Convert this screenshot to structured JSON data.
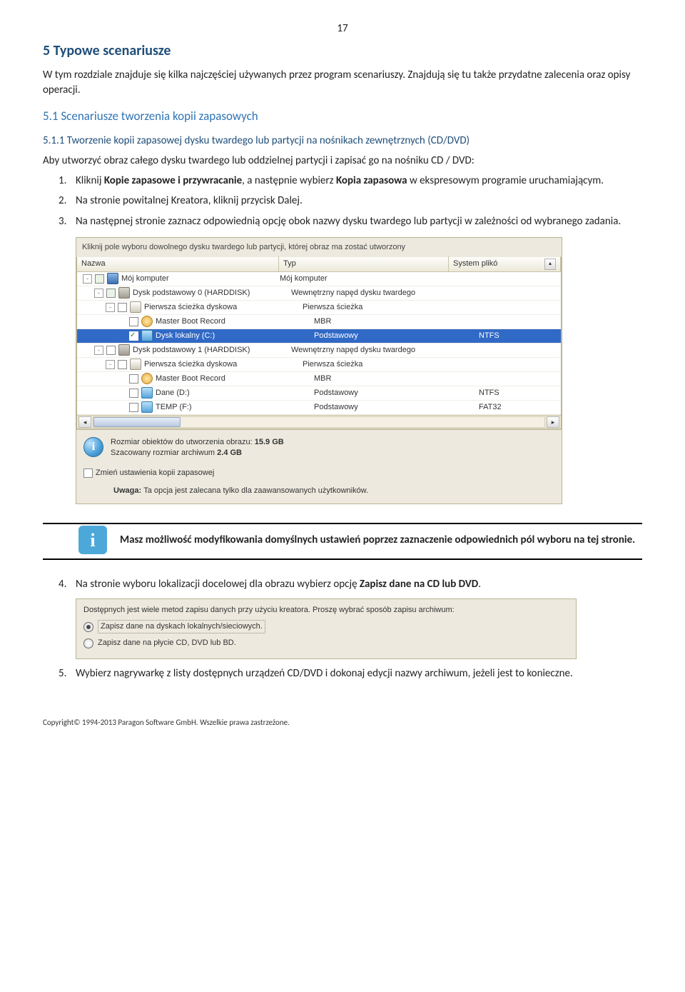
{
  "page_number": "17",
  "h1": "5   Typowe scenariusze",
  "intro": "W tym rozdziale znajduje się kilka najczęściej używanych przez program scenariuszy. Znajdują się tu także przydatne zalecenia oraz opisy operacji.",
  "h2": "5.1   Scenariusze tworzenia kopii zapasowych",
  "h3": "5.1.1   Tworzenie kopii zapasowej dysku twardego lub partycji na nośnikach zewnętrznych (CD/DVD)",
  "p_aim": "Aby utworzyć obraz całego dysku twardego lub oddzielnej partycji i zapisać go na nośniku CD / DVD:",
  "steps": {
    "s1_n": "1.",
    "s1_a": "Kliknij ",
    "s1_b": "Kopie zapasowe i przywracanie",
    "s1_c": ", a następnie wybierz ",
    "s1_d": "Kopia zapasowa",
    "s1_e": " w ekspresowym programie uruchamiającym.",
    "s2_n": "2.",
    "s2": "Na stronie powitalnej Kreatora, kliknij przycisk Dalej.",
    "s3_n": "3.",
    "s3": "Na następnej stronie zaznacz odpowiednią opcję obok nazwy dysku twardego lub partycji w zależności od wybranego zadania.",
    "s4_n": "4.",
    "s4_a": "Na stronie wyboru lokalizacji docelowej dla obrazu wybierz opcję ",
    "s4_b": "Zapisz dane na CD lub DVD",
    "s4_c": ".",
    "s5_n": "5.",
    "s5": "Wybierz nagrywarkę z listy dostępnych urządzeń CD/DVD i dokonaj edycji nazwy archiwum, jeżeli jest to konieczne."
  },
  "ss1": {
    "instr": "Kliknij pole wyboru dowolnego dysku twardego lub partycji, której obraz ma zostać utworzony",
    "head_name": "Nazwa",
    "head_type": "Typ",
    "head_fs": "System plikó",
    "rows": [
      {
        "ind": 8,
        "tog": "-",
        "chk": "half",
        "icon": "computer",
        "name": "Mój komputer",
        "type": "Mój komputer",
        "fs": ""
      },
      {
        "ind": 24,
        "tog": "-",
        "chk": "half",
        "icon": "hdd",
        "name": "Dysk podstawowy 0 (HARDDISK)",
        "type": "Wewnętrzny napęd dysku twardego",
        "fs": ""
      },
      {
        "ind": 40,
        "tog": "-",
        "chk": "",
        "icon": "track",
        "name": "Pierwsza ścieżka dyskowa",
        "type": "Pierwsza ścieżka",
        "fs": ""
      },
      {
        "ind": 56,
        "tog": "",
        "chk": "",
        "icon": "mbr",
        "name": "Master Boot Record",
        "type": "MBR",
        "fs": ""
      },
      {
        "ind": 56,
        "tog": "",
        "chk": "on",
        "icon": "drive",
        "name": "Dysk lokalny (C:)",
        "type": "Podstawowy",
        "fs": "NTFS",
        "sel": true
      },
      {
        "ind": 24,
        "tog": "-",
        "chk": "",
        "icon": "hdd",
        "name": "Dysk podstawowy 1 (HARDDISK)",
        "type": "Wewnętrzny napęd dysku twardego",
        "fs": ""
      },
      {
        "ind": 40,
        "tog": "-",
        "chk": "",
        "icon": "track",
        "name": "Pierwsza ścieżka dyskowa",
        "type": "Pierwsza ścieżka",
        "fs": ""
      },
      {
        "ind": 56,
        "tog": "",
        "chk": "",
        "icon": "mbr",
        "name": "Master Boot Record",
        "type": "MBR",
        "fs": ""
      },
      {
        "ind": 56,
        "tog": "",
        "chk": "",
        "icon": "drive",
        "name": "Dane (D:)",
        "type": "Podstawowy",
        "fs": "NTFS"
      },
      {
        "ind": 56,
        "tog": "",
        "chk": "",
        "icon": "drive",
        "name": "TEMP (F:)",
        "type": "Podstawowy",
        "fs": "FAT32"
      }
    ],
    "info_a": "Rozmiar obiektów do utworzenia obrazu: ",
    "info_b": "15.9 GB",
    "info_c": "Szacowany rozmiar archiwum ",
    "info_d": "2.4 GB",
    "change": "Zmień ustawienia kopii zapasowej",
    "note_a": "Uwaga: ",
    "note_b": "Ta opcja jest zalecana tylko dla zaawansowanych użytkowników."
  },
  "tip": "Masz możliwość modyfikowania domyślnych ustawień poprzez zaznaczenie odpowiednich pól wyboru na tej stronie.",
  "ss2": {
    "intro": "Dostępnych jest wiele metod zapisu danych przy użyciu kreatora. Proszę wybrać sposób zapisu archiwum:",
    "opt1": "Zapisz dane na dyskach lokalnych/sieciowych.",
    "opt2": "Zapisz dane na płycie CD, DVD lub BD."
  },
  "copyright": "Copyright© 1994-2013 Paragon Software GmbH. Wszelkie prawa zastrzeżone."
}
